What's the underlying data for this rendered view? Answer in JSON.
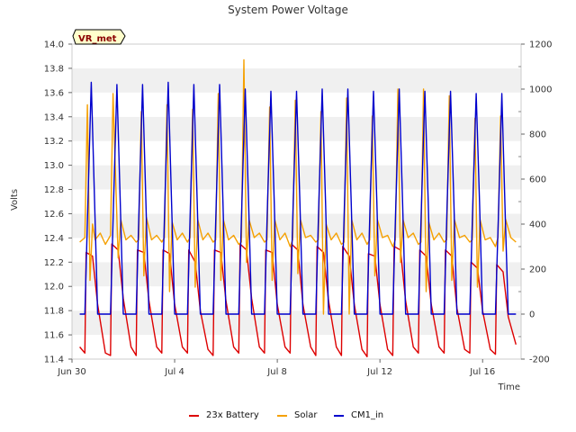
{
  "chart_data": {
    "type": "line",
    "title": "System Power Voltage",
    "site_label": "VR_met",
    "xlabel": "Time",
    "ylabel": "Volts",
    "x_unit": "days since Jun 30",
    "xlim": [
      0,
      17.5
    ],
    "x_ticks": [
      {
        "value": 0,
        "label": "Jun 30"
      },
      {
        "value": 4,
        "label": "Jul 4"
      },
      {
        "value": 8,
        "label": "Jul 8"
      },
      {
        "value": 12,
        "label": "Jul 12"
      },
      {
        "value": 16,
        "label": "Jul 16"
      }
    ],
    "ylim_left": [
      11.4,
      14.0
    ],
    "y_ticks_left": [
      "11.4",
      "11.6",
      "11.8",
      "12.0",
      "12.2",
      "12.4",
      "12.6",
      "12.8",
      "13.0",
      "13.2",
      "13.4",
      "13.6",
      "13.8",
      "14.0"
    ],
    "ylim_right": [
      -200,
      1200
    ],
    "y_ticks_right": [
      "-200",
      "0",
      "200",
      "400",
      "600",
      "800",
      "1000",
      "1200"
    ],
    "grid": "horizontal bands",
    "legend_position": "bottom",
    "series": [
      {
        "name": "23x Battery",
        "axis": "left",
        "color": "#dd0000",
        "x": [
          0.3,
          0.5,
          0.55,
          0.8,
          1.0,
          1.3,
          1.5,
          1.55,
          1.8,
          2.0,
          2.3,
          2.5,
          2.55,
          2.8,
          3.0,
          3.3,
          3.5,
          3.55,
          3.8,
          4.0,
          4.3,
          4.5,
          4.55,
          4.8,
          5.0,
          5.3,
          5.5,
          5.55,
          5.8,
          6.0,
          6.3,
          6.5,
          6.55,
          6.8,
          7.0,
          7.3,
          7.5,
          7.55,
          7.8,
          8.0,
          8.3,
          8.5,
          8.55,
          8.8,
          9.0,
          9.3,
          9.5,
          9.55,
          9.8,
          10.0,
          10.3,
          10.5,
          10.55,
          10.8,
          11.0,
          11.3,
          11.5,
          11.55,
          11.8,
          12.0,
          12.3,
          12.5,
          12.55,
          12.8,
          13.0,
          13.3,
          13.5,
          13.55,
          13.8,
          14.0,
          14.3,
          14.5,
          14.55,
          14.8,
          15.0,
          15.3,
          15.5,
          15.55,
          15.8,
          16.0,
          16.3,
          16.5,
          16.55,
          16.8,
          17.0,
          17.3
        ],
        "values": [
          11.5,
          11.45,
          12.28,
          12.25,
          11.85,
          11.45,
          11.43,
          12.35,
          12.3,
          11.9,
          11.5,
          11.43,
          12.3,
          12.28,
          11.88,
          11.5,
          11.45,
          12.3,
          12.27,
          11.85,
          11.5,
          11.45,
          12.3,
          12.2,
          11.8,
          11.48,
          11.43,
          12.3,
          12.28,
          11.88,
          11.5,
          11.45,
          12.35,
          12.3,
          11.9,
          11.5,
          11.45,
          12.3,
          12.28,
          11.85,
          11.5,
          11.45,
          12.35,
          12.3,
          11.85,
          11.5,
          11.43,
          12.33,
          12.28,
          11.88,
          11.5,
          11.43,
          12.33,
          12.25,
          11.85,
          11.48,
          11.42,
          12.27,
          12.25,
          11.85,
          11.48,
          11.43,
          12.33,
          12.3,
          11.88,
          11.5,
          11.45,
          12.3,
          12.25,
          11.85,
          11.5,
          11.45,
          12.3,
          12.25,
          11.82,
          11.48,
          11.45,
          12.2,
          12.15,
          11.8,
          11.48,
          11.44,
          12.18,
          12.12,
          11.75,
          11.52
        ]
      },
      {
        "name": "Solar",
        "axis": "right",
        "color": "#f5a000",
        "x": [
          0.3,
          0.5,
          0.6,
          0.7,
          0.8,
          0.9,
          1.1,
          1.3,
          1.5,
          1.6,
          1.7,
          1.8,
          1.9,
          2.1,
          2.3,
          2.5,
          2.6,
          2.7,
          2.8,
          2.9,
          3.1,
          3.3,
          3.5,
          3.6,
          3.7,
          3.8,
          3.9,
          4.1,
          4.3,
          4.5,
          4.6,
          4.7,
          4.8,
          4.9,
          5.1,
          5.3,
          5.5,
          5.6,
          5.7,
          5.8,
          5.9,
          6.1,
          6.3,
          6.5,
          6.6,
          6.7,
          6.8,
          6.9,
          7.1,
          7.3,
          7.5,
          7.6,
          7.7,
          7.8,
          7.9,
          8.1,
          8.3,
          8.5,
          8.6,
          8.7,
          8.8,
          8.9,
          9.1,
          9.3,
          9.5,
          9.6,
          9.7,
          9.8,
          9.9,
          10.1,
          10.3,
          10.5,
          10.6,
          10.7,
          10.8,
          10.9,
          11.1,
          11.3,
          11.5,
          11.6,
          11.7,
          11.8,
          11.9,
          12.1,
          12.3,
          12.5,
          12.6,
          12.7,
          12.8,
          12.9,
          13.1,
          13.3,
          13.5,
          13.6,
          13.7,
          13.8,
          13.9,
          14.1,
          14.3,
          14.5,
          14.6,
          14.7,
          14.8,
          14.9,
          15.1,
          15.3,
          15.5,
          15.6,
          15.7,
          15.8,
          15.9,
          16.1,
          16.3,
          16.5,
          16.6,
          16.7,
          16.8,
          16.9,
          17.1,
          17.3
        ],
        "values": [
          320,
          340,
          930,
          150,
          400,
          330,
          360,
          310,
          350,
          980,
          600,
          250,
          420,
          330,
          350,
          320,
          330,
          900,
          170,
          430,
          330,
          350,
          320,
          340,
          930,
          100,
          410,
          330,
          360,
          320,
          340,
          910,
          120,
          420,
          330,
          360,
          320,
          330,
          980,
          150,
          420,
          330,
          350,
          310,
          320,
          1130,
          230,
          420,
          340,
          360,
          320,
          330,
          920,
          150,
          420,
          330,
          360,
          300,
          330,
          950,
          180,
          420,
          340,
          350,
          320,
          330,
          900,
          0,
          400,
          330,
          360,
          310,
          320,
          960,
          0,
          420,
          330,
          360,
          310,
          330,
          880,
          170,
          420,
          340,
          350,
          300,
          330,
          1000,
          230,
          420,
          340,
          360,
          310,
          320,
          1000,
          100,
          410,
          330,
          360,
          320,
          330,
          970,
          150,
          420,
          340,
          350,
          320,
          330,
          870,
          120,
          420,
          330,
          340,
          300,
          340,
          880,
          280,
          420,
          340,
          320
        ]
      },
      {
        "name": "CM1_in",
        "axis": "right",
        "color": "#0000cc",
        "x": [
          0.3,
          0.5,
          0.62,
          0.75,
          0.88,
          1.0,
          1.5,
          1.62,
          1.75,
          1.88,
          2.0,
          2.5,
          2.62,
          2.75,
          2.88,
          3.0,
          3.5,
          3.62,
          3.75,
          3.88,
          4.0,
          4.5,
          4.62,
          4.75,
          4.88,
          5.0,
          5.5,
          5.62,
          5.75,
          5.88,
          6.0,
          6.5,
          6.62,
          6.75,
          6.88,
          7.0,
          7.5,
          7.62,
          7.75,
          7.88,
          8.0,
          8.5,
          8.62,
          8.75,
          8.88,
          9.0,
          9.5,
          9.62,
          9.75,
          9.88,
          10.0,
          10.5,
          10.62,
          10.75,
          10.88,
          11.0,
          11.5,
          11.62,
          11.75,
          11.88,
          12.0,
          12.5,
          12.62,
          12.75,
          12.88,
          13.0,
          13.5,
          13.62,
          13.75,
          13.88,
          14.0,
          14.5,
          14.62,
          14.75,
          14.88,
          15.0,
          15.5,
          15.62,
          15.75,
          15.88,
          16.0,
          16.5,
          16.62,
          16.75,
          16.88,
          17.0,
          17.3
        ],
        "values": [
          0,
          0,
          500,
          1030,
          500,
          0,
          0,
          500,
          1020,
          500,
          0,
          0,
          500,
          1020,
          500,
          0,
          0,
          500,
          1030,
          500,
          0,
          0,
          500,
          1020,
          500,
          0,
          0,
          500,
          1020,
          500,
          0,
          0,
          500,
          1000,
          500,
          0,
          0,
          500,
          990,
          500,
          0,
          0,
          500,
          990,
          500,
          0,
          0,
          500,
          1000,
          500,
          0,
          0,
          500,
          1000,
          500,
          0,
          0,
          500,
          990,
          500,
          0,
          0,
          500,
          1000,
          500,
          0,
          0,
          500,
          990,
          500,
          0,
          0,
          500,
          990,
          500,
          0,
          0,
          500,
          980,
          500,
          0,
          0,
          450,
          980,
          450,
          0,
          0
        ]
      }
    ]
  }
}
